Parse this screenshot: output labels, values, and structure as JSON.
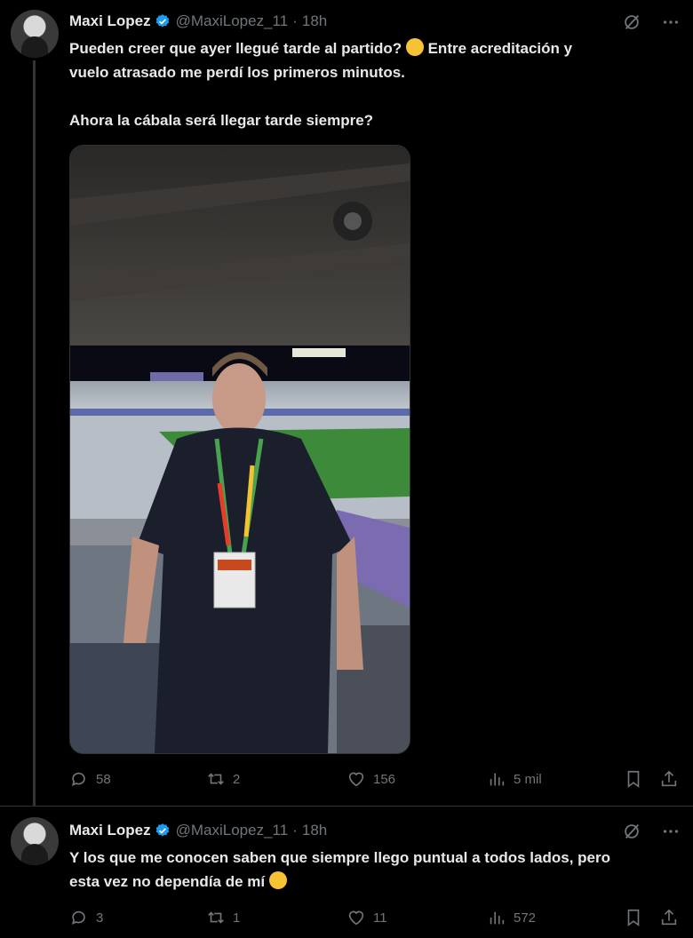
{
  "tweets": [
    {
      "name": "Maxi Lopez",
      "handle": "@MaxiLopez_11",
      "separator": "·",
      "time": "18h",
      "text_line1": "Pueden creer que ayer llegué tarde al partido?",
      "text_line1b": "Entre acreditación y",
      "text_line2": "vuelo atrasado me perdí los primeros minutos.",
      "text_line3": "Ahora la cábala será llegar tarde siempre?",
      "replies": "58",
      "retweets": "2",
      "likes": "156",
      "views": "5 mil"
    },
    {
      "name": "Maxi Lopez",
      "handle": "@MaxiLopez_11",
      "separator": "·",
      "time": "18h",
      "text_line1": "Y los que me conocen saben que siempre llego puntual a todos lados, pero",
      "text_line2": "esta vez no dependía de mí",
      "replies": "3",
      "retweets": "1",
      "likes": "11",
      "views": "572"
    }
  ],
  "icons": {
    "verified": "verified-badge-icon",
    "grok": "grok-icon",
    "more": "more-icon",
    "reply": "reply-icon",
    "retweet": "retweet-icon",
    "like": "heart-icon",
    "views": "views-icon",
    "bookmark": "bookmark-icon",
    "share": "share-icon"
  },
  "colors": {
    "background": "#000000",
    "text": "#e7e9ea",
    "muted": "#71767b",
    "verified": "#1d9bf0"
  }
}
